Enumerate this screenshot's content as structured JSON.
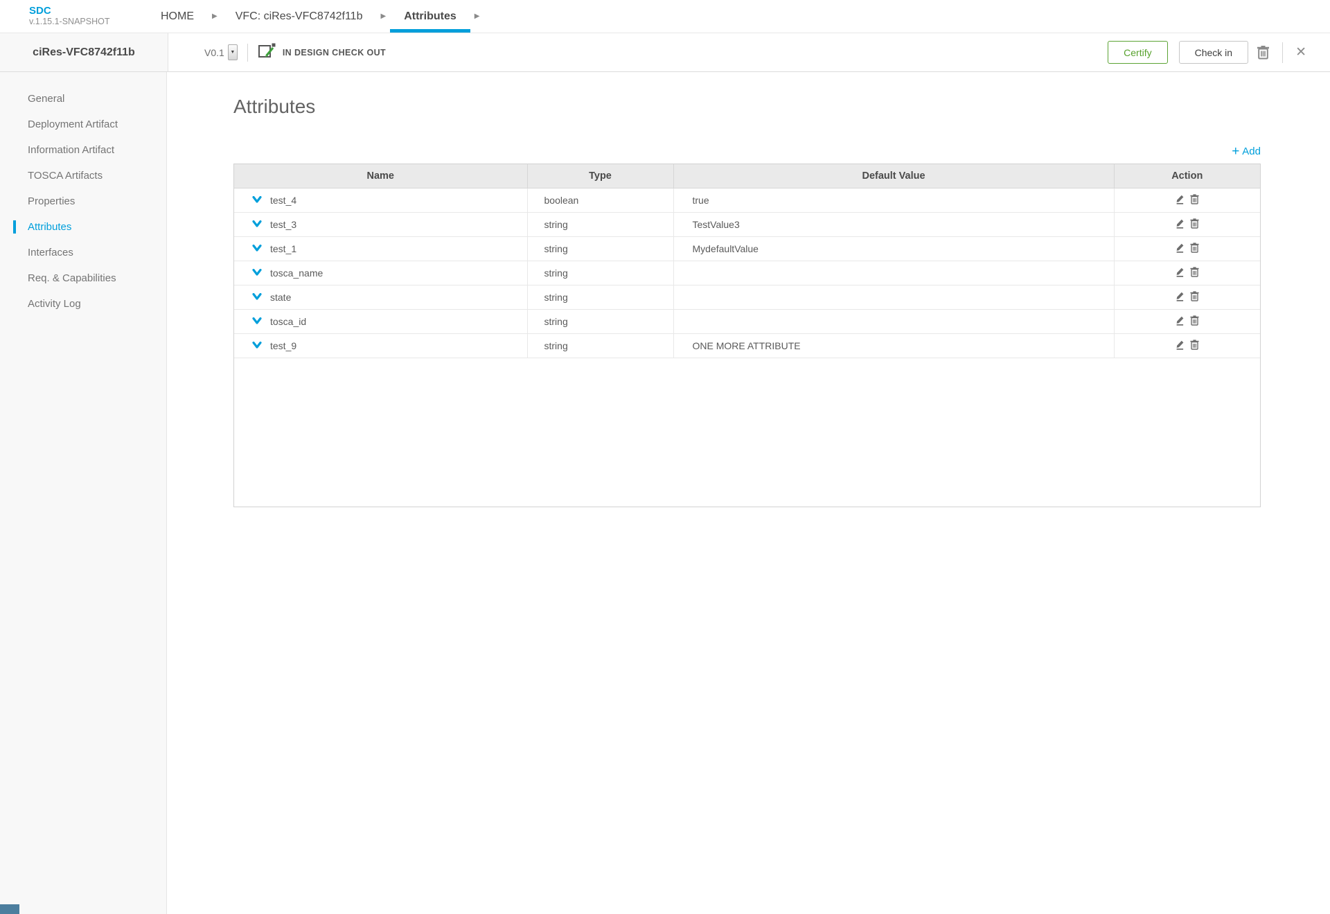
{
  "header": {
    "logo": {
      "title": "SDC",
      "version": "v.1.15.1-SNAPSHOT"
    },
    "breadcrumbs": [
      {
        "label": "HOME",
        "active": false
      },
      {
        "label": "VFC: ciRes-VFC8742f11b",
        "active": false
      },
      {
        "label": "Attributes",
        "active": true
      }
    ]
  },
  "toolbar": {
    "entity_name": "ciRes-VFC8742f11b",
    "version": "V0.1",
    "lifecycle_state": "IN DESIGN CHECK OUT",
    "certify_label": "Certify",
    "checkin_label": "Check in"
  },
  "sidebar": {
    "items": [
      {
        "label": "General",
        "active": false
      },
      {
        "label": "Deployment Artifact",
        "active": false
      },
      {
        "label": "Information Artifact",
        "active": false
      },
      {
        "label": "TOSCA Artifacts",
        "active": false
      },
      {
        "label": "Properties",
        "active": false
      },
      {
        "label": "Attributes",
        "active": true
      },
      {
        "label": "Interfaces",
        "active": false
      },
      {
        "label": "Req. & Capabilities",
        "active": false
      },
      {
        "label": "Activity Log",
        "active": false
      }
    ]
  },
  "main": {
    "title": "Attributes",
    "add": {
      "plus": "+",
      "label": "Add"
    },
    "table": {
      "columns": [
        "Name",
        "Type",
        "Default Value",
        "Action"
      ],
      "rows": [
        {
          "name": "test_4",
          "type": "boolean",
          "default_value": "true"
        },
        {
          "name": "test_3",
          "type": "string",
          "default_value": "TestValue3"
        },
        {
          "name": "test_1",
          "type": "string",
          "default_value": "MydefaultValue"
        },
        {
          "name": "tosca_name",
          "type": "string",
          "default_value": ""
        },
        {
          "name": "state",
          "type": "string",
          "default_value": ""
        },
        {
          "name": "tosca_id",
          "type": "string",
          "default_value": ""
        },
        {
          "name": "test_9",
          "type": "string",
          "default_value": "ONE MORE ATTRIBUTE"
        }
      ]
    }
  },
  "colors": {
    "accent_blue": "#009fdb",
    "certify_green": "#5ba333",
    "icon_gray": "#6d6d6d",
    "bottom_accent": "#4c7e9e"
  }
}
